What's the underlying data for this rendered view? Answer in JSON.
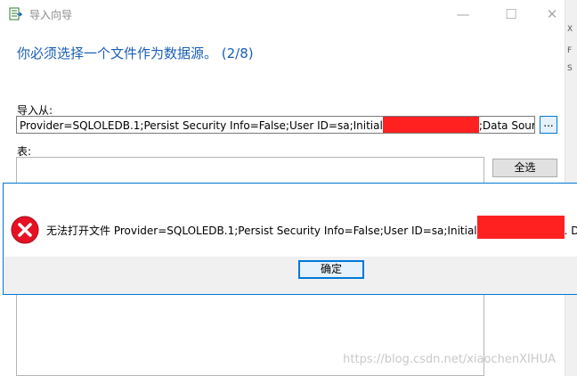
{
  "window": {
    "title": "导入向导",
    "minimize_glyph": "—",
    "maximize_glyph": "☐",
    "close_glyph": "✕"
  },
  "heading": "你必须选择一个文件作为数据源。 (2/8)",
  "import_from": {
    "label": "导入从:",
    "value_prefix": "Provider=SQLOLEDB.1;Persist Security Info=False;User ID=sa;Initial",
    "value_suffix": ";Data Source=",
    "browse_label": "..."
  },
  "tables": {
    "label": "表:",
    "select_all_label": "全选"
  },
  "error_dialog": {
    "icon": "error-icon",
    "message_prefix": "无法打开文件 Provider=SQLOLEDB.1;Persist Security Info=False;User ID=sa;Initial",
    "message_suffix": ". Dat",
    "ok_label": "确定"
  },
  "side_marks": [
    "X",
    "F",
    "S"
  ],
  "watermark": "https://blog.csdn.net/xiaochenXIHUA",
  "colors": {
    "accent": "#0078d7",
    "heading": "#1a5fb4",
    "redaction": "#ff2020",
    "error": "#e81123"
  }
}
